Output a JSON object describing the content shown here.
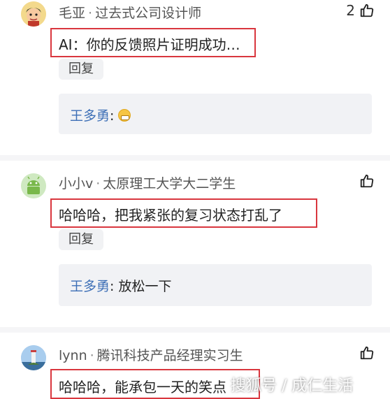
{
  "comments": [
    {
      "username": "毛亚",
      "title": "过去式公司设计师",
      "likes": "2",
      "content": "AI：你的反馈照片证明成功…",
      "reply_button": "回复",
      "reply": {
        "name": "王多勇",
        "colon": ":",
        "text": "",
        "emoji": "grin-emoji"
      }
    },
    {
      "username": "小小v",
      "title": "太原理工大学大二学生",
      "likes": "",
      "content": "哈哈哈，把我紧张的复习状态打乱了",
      "reply_button": "回复",
      "reply": {
        "name": "王多勇",
        "colon": ":",
        "text": " 放松一下"
      }
    },
    {
      "username": "lynn",
      "title": "腾讯科技产品经理实习生",
      "likes": "",
      "content": "哈哈哈，能承包一天的笑点"
    }
  ],
  "separator": "·",
  "watermark": "搜狐号 / 成仁生活"
}
